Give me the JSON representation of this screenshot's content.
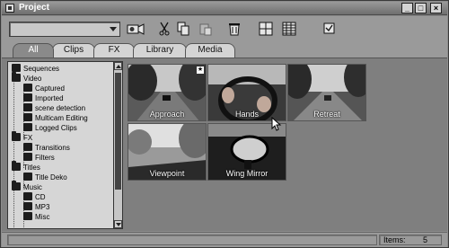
{
  "window": {
    "title": "Project",
    "minimize": "_",
    "maximize": "□",
    "close": "×"
  },
  "toolbar": {
    "combo_value": "",
    "icons": [
      "camera-icon",
      "scissors-icon",
      "copy-icon",
      "paste-icon",
      "trash-icon",
      "grid-view-icon",
      "list-view-icon",
      "checkbox-icon"
    ]
  },
  "tabs": [
    "All",
    "Clips",
    "FX",
    "Library",
    "Media"
  ],
  "active_tab": "All",
  "tree": {
    "items": [
      {
        "label": "Sequences",
        "level": 0
      },
      {
        "label": "Video",
        "level": 0
      },
      {
        "label": "Captured",
        "level": 1
      },
      {
        "label": "Imported",
        "level": 1
      },
      {
        "label": "scene detection",
        "level": 1
      },
      {
        "label": "Multicam Editing",
        "level": 1
      },
      {
        "label": "Logged Clips",
        "level": 1
      },
      {
        "label": "FX",
        "level": 0
      },
      {
        "label": "Transitions",
        "level": 1
      },
      {
        "label": "Filters",
        "level": 1
      },
      {
        "label": "Titles",
        "level": 0
      },
      {
        "label": "Title Deko",
        "level": 1
      },
      {
        "label": "Music",
        "level": 0
      },
      {
        "label": "CD",
        "level": 1
      },
      {
        "label": "MP3",
        "level": 1
      },
      {
        "label": "Misc",
        "level": 1
      }
    ]
  },
  "clips": [
    {
      "label": "Approach",
      "starred": true
    },
    {
      "label": "Hands",
      "starred": false
    },
    {
      "label": "Retreat",
      "starred": false
    },
    {
      "label": "Viewpoint",
      "starred": false
    },
    {
      "label": "Wing Mirror",
      "starred": false
    }
  ],
  "status": {
    "items_label": "Items:",
    "items_count": "5"
  }
}
